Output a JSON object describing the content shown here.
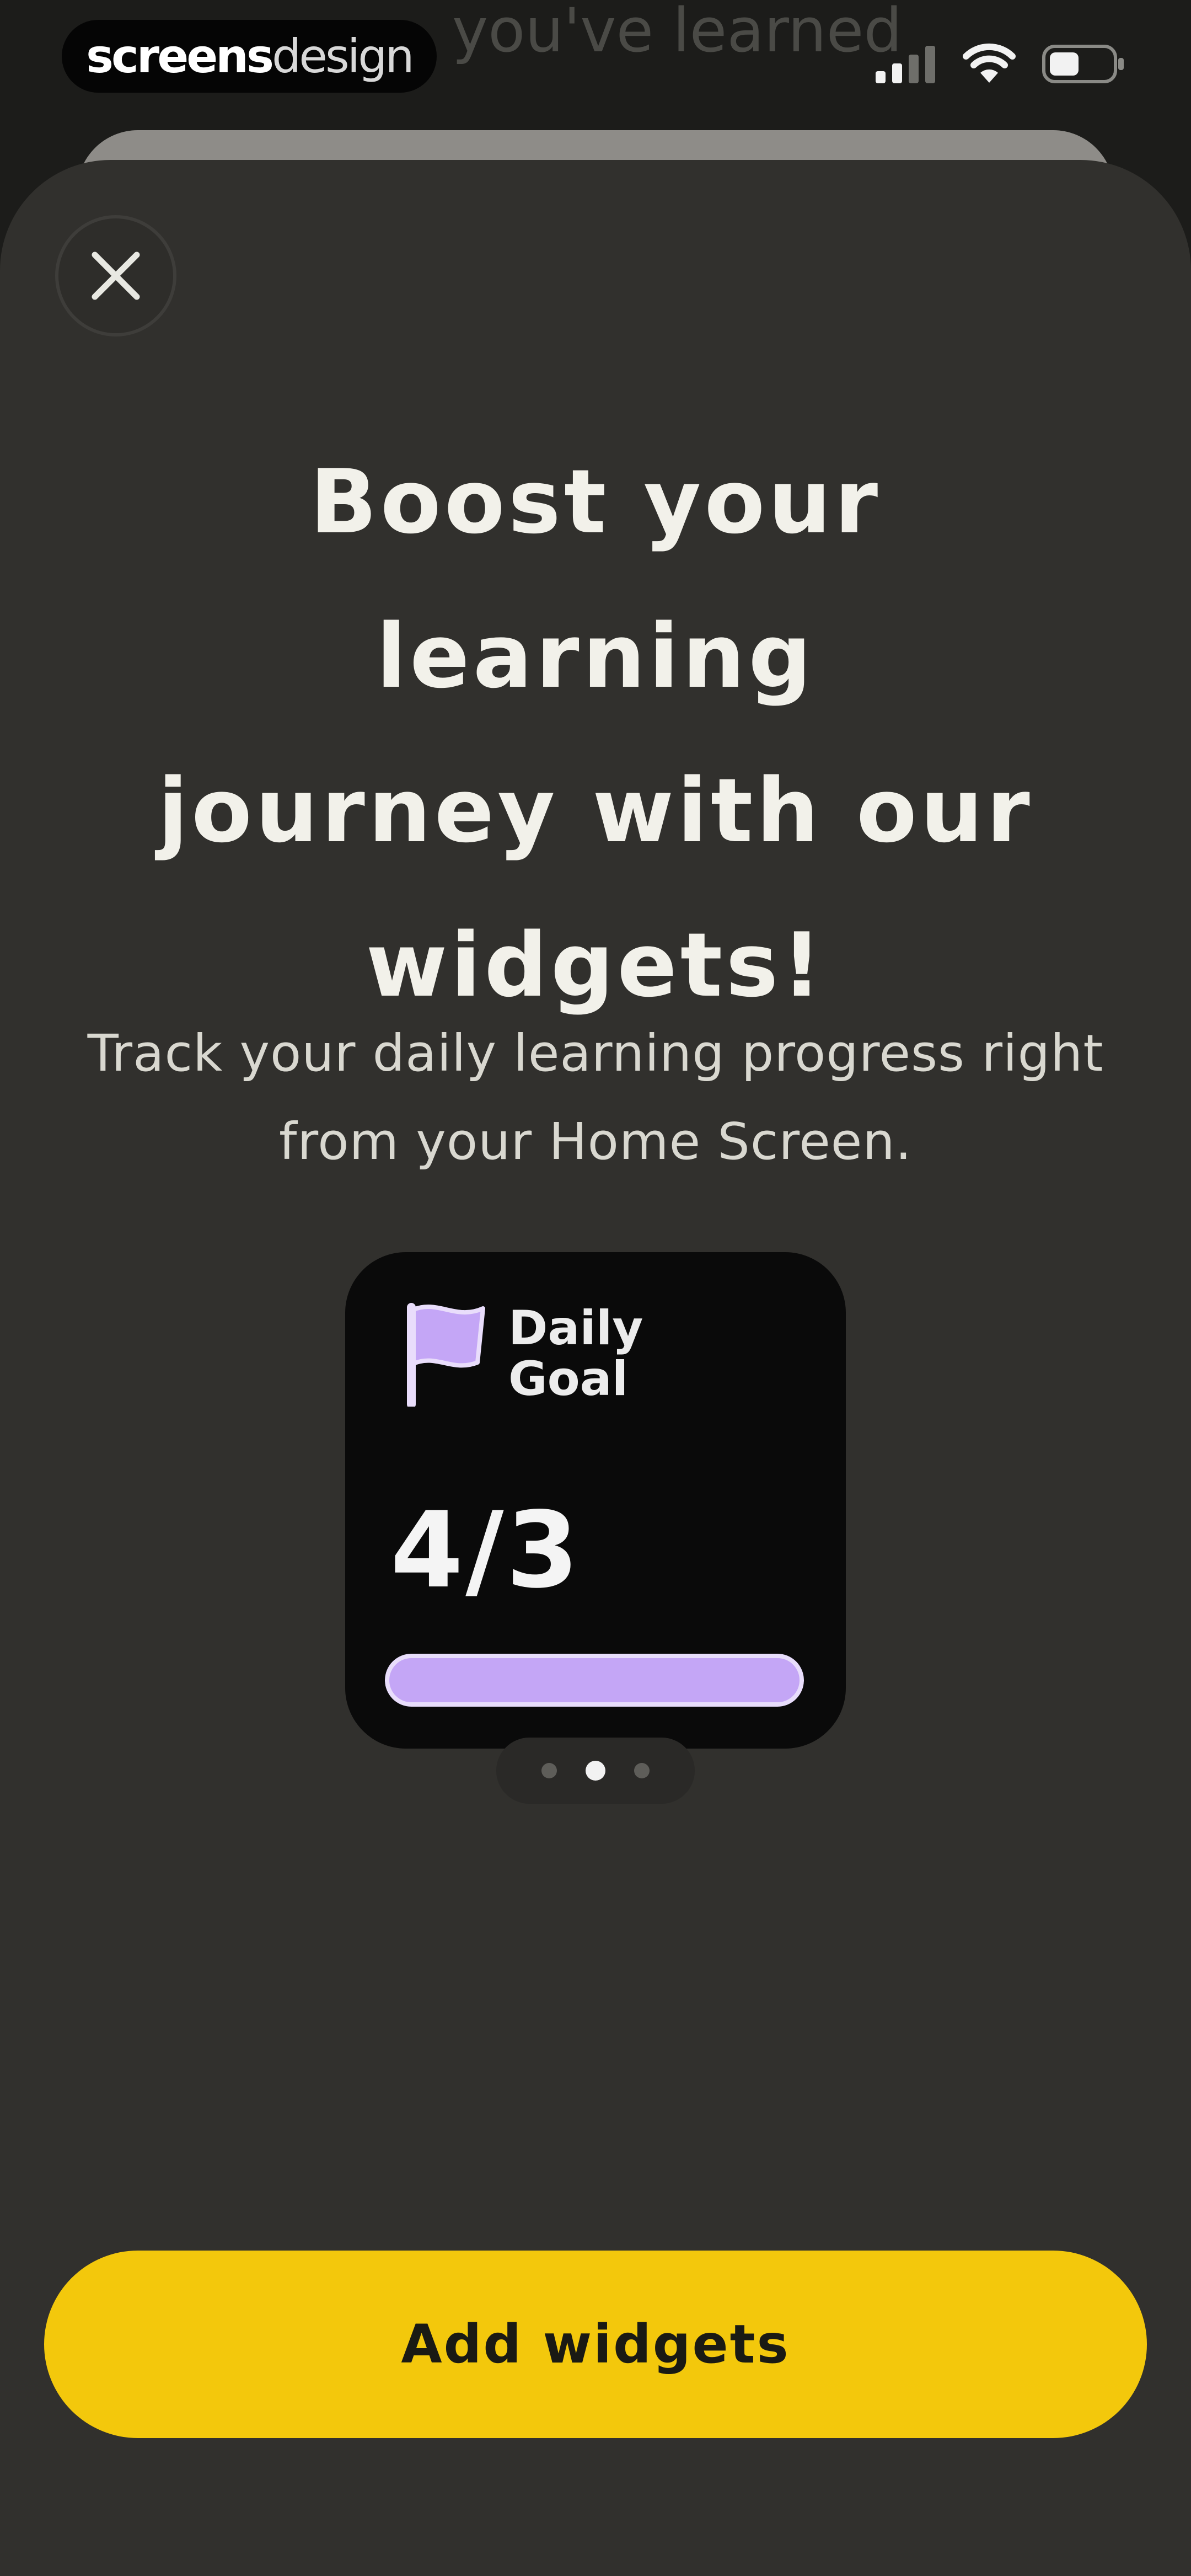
{
  "status_bar": {
    "brand_bold": "screens",
    "brand_light": "design",
    "background_title": "you've learned",
    "icons": [
      "cellular-signal-icon",
      "wifi-icon",
      "battery-icon"
    ]
  },
  "sheet": {
    "close_icon": "close-icon",
    "headline_lines": [
      "Boost your learning",
      "journey with our",
      "widgets!"
    ],
    "subtitle_lines": [
      "Track your daily learning progress right",
      "from your Home Screen."
    ]
  },
  "widget": {
    "icon": "flag-icon",
    "label_lines": [
      "Daily",
      "Goal"
    ],
    "value": "4/3",
    "progress_fraction": 1.0
  },
  "pager": {
    "page_count": 3,
    "active_index": 1
  },
  "cta": {
    "label": "Add widgets"
  },
  "colors": {
    "background": "#1c1c1a",
    "sheet": "#31302d",
    "widget": "#0a0a0a",
    "accent_purple": "#c4a6f6",
    "cta_yellow": "#f3c80c",
    "text_primary": "#f2f1ea"
  }
}
